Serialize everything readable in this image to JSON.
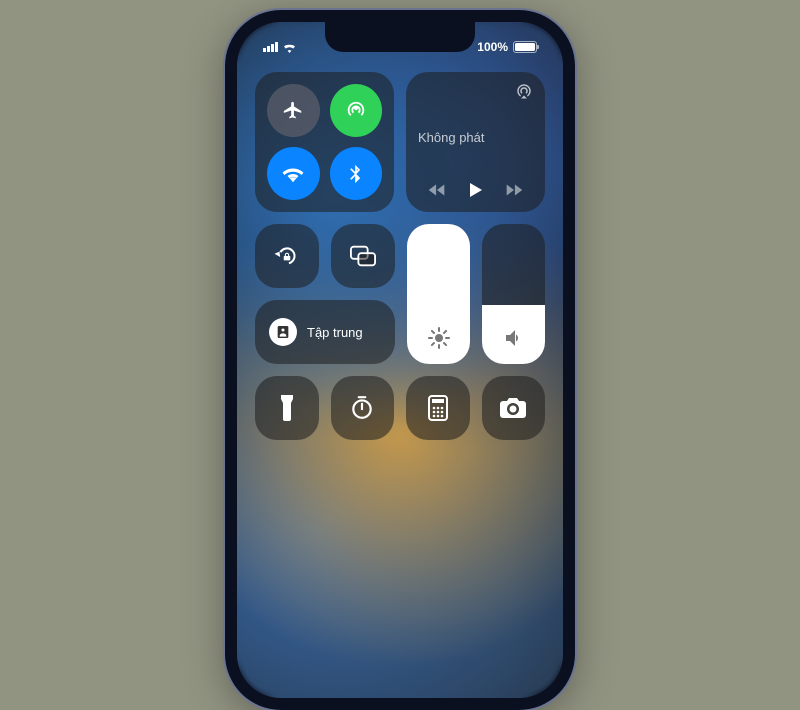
{
  "status": {
    "battery_text": "100%",
    "battery_level": 100
  },
  "media": {
    "title": "Không phát"
  },
  "focus": {
    "label": "Tập trung"
  },
  "sliders": {
    "brightness_pct": 100,
    "volume_pct": 42
  },
  "highlight_target": "brightness-slider"
}
